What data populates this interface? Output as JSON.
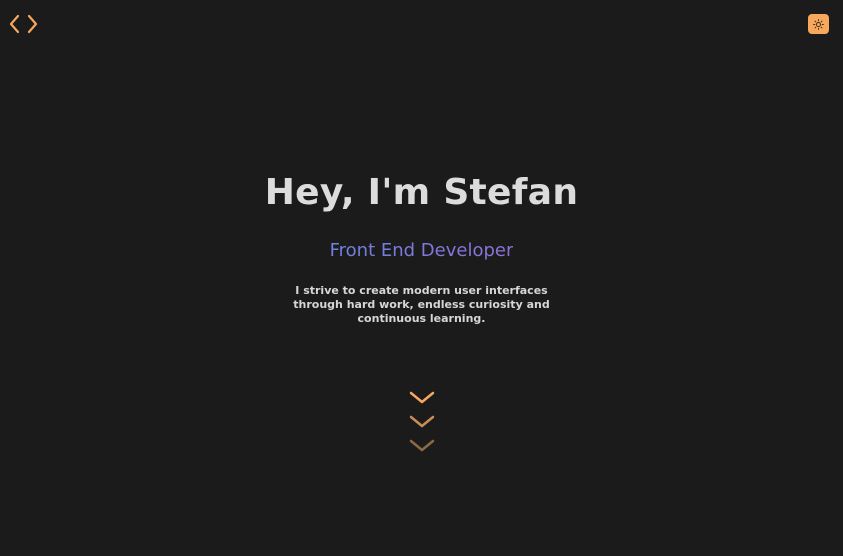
{
  "header": {
    "logo_icon": "code-brackets-icon",
    "theme_toggle_icon": "sun-icon"
  },
  "hero": {
    "title": "Hey, I'm Stefan",
    "role": "Front End Developer",
    "description": "I strive to create modern user interfaces through hard work, endless curiosity and continuous learning."
  },
  "scroll_cue": {
    "icon": "chevron-down-icon"
  },
  "colors": {
    "background": "#1c1b1b",
    "accent": "#f7a85c",
    "title": "#dcdcdc",
    "role_gradient_start": "#6e82e2",
    "role_gradient_end": "#8d72d8",
    "description": "#d6d6d6"
  }
}
